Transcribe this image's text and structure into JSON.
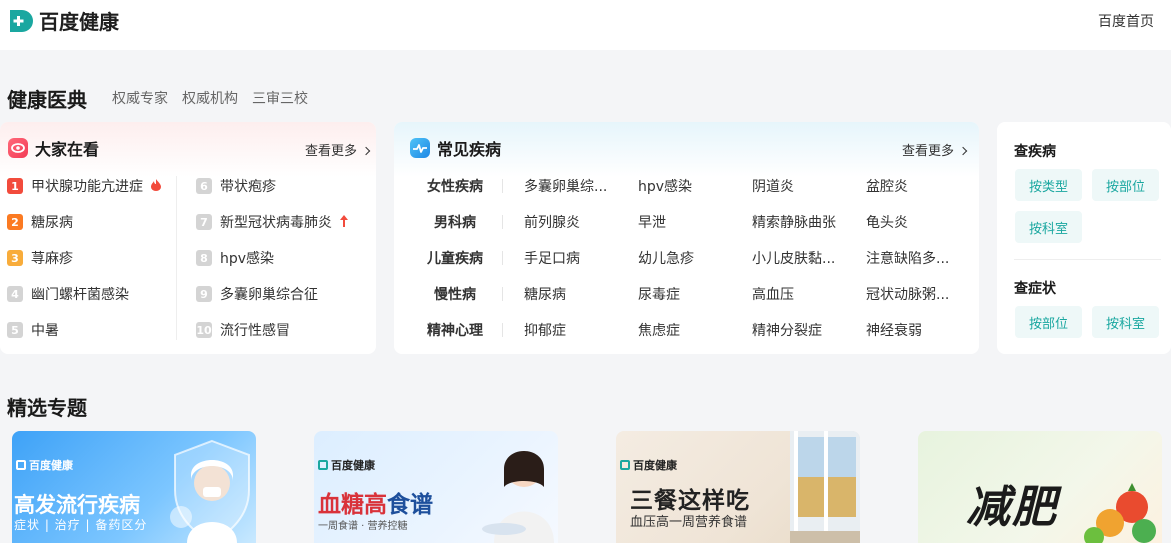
{
  "header": {
    "logo_text": "百度健康",
    "home_link": "百度首页"
  },
  "dictionary": {
    "title": "健康医典",
    "links": [
      "权威专家",
      "权威机构",
      "三审三校"
    ]
  },
  "popular": {
    "title": "大家在看",
    "more": "查看更多",
    "left": [
      {
        "rank": "1",
        "label": "甲状腺功能亢进症",
        "badge": "hot"
      },
      {
        "rank": "2",
        "label": "糖尿病"
      },
      {
        "rank": "3",
        "label": "荨麻疹"
      },
      {
        "rank": "4",
        "label": "幽门螺杆菌感染"
      },
      {
        "rank": "5",
        "label": "中暑"
      }
    ],
    "right": [
      {
        "rank": "6",
        "label": "带状疱疹"
      },
      {
        "rank": "7",
        "label": "新型冠状病毒肺炎",
        "badge": "up"
      },
      {
        "rank": "8",
        "label": "hpv感染"
      },
      {
        "rank": "9",
        "label": "多囊卵巢综合征"
      },
      {
        "rank": "10",
        "label": "流行性感冒"
      }
    ]
  },
  "common": {
    "title": "常见疾病",
    "more": "查看更多",
    "rows": [
      {
        "category": "女性疾病",
        "items": [
          "多囊卵巢综...",
          "hpv感染",
          "阴道炎",
          "盆腔炎"
        ]
      },
      {
        "category": "男科病",
        "items": [
          "前列腺炎",
          "早泄",
          "精索静脉曲张",
          "龟头炎"
        ]
      },
      {
        "category": "儿童疾病",
        "items": [
          "手足口病",
          "幼儿急疹",
          "小儿皮肤黏...",
          "注意缺陷多..."
        ]
      },
      {
        "category": "慢性病",
        "items": [
          "糖尿病",
          "尿毒症",
          "高血压",
          "冠状动脉粥..."
        ]
      },
      {
        "category": "精神心理",
        "items": [
          "抑郁症",
          "焦虑症",
          "精神分裂症",
          "神经衰弱"
        ]
      }
    ]
  },
  "check": {
    "disease_title": "查疾病",
    "disease_buttons": [
      "按类型",
      "按部位",
      "按科室"
    ],
    "symptom_title": "查症状",
    "symptom_buttons": [
      "按部位",
      "按科室"
    ]
  },
  "featured": {
    "title": "精选专题",
    "banners": [
      {
        "logo": "百度健康",
        "headline": "高发流行疾病",
        "sub": "症状 | 治疗 | 备药区分"
      },
      {
        "logo": "百度健康",
        "headline_a": "血糖高",
        "headline_b": "食谱",
        "sub": "一周食谱 · 营养控糖"
      },
      {
        "logo": "百度健康",
        "headline": "三餐这样吃",
        "sub": "血压高一周营养食谱"
      },
      {
        "headline": "减肥"
      }
    ]
  },
  "colors": {
    "brand": "#1aa7a0",
    "rank1": "#f24b3c",
    "rank2": "#fb7a22",
    "rank3": "#f8ac3b",
    "rank_other": "#d4d4d4"
  }
}
